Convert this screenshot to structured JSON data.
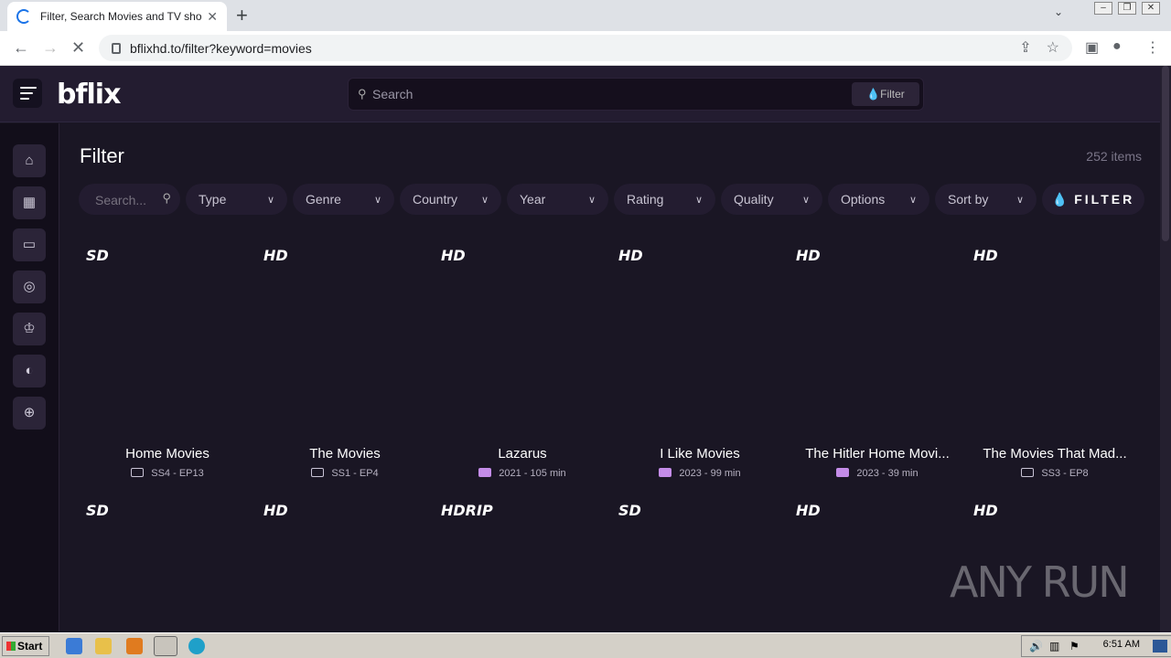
{
  "browser": {
    "tab_title": "Filter, Search Movies and TV shows",
    "url": "bflixhd.to/filter?keyword=movies"
  },
  "header": {
    "logo_main": "bflix",
    "search_placeholder": "Search",
    "filter_button": "Filter"
  },
  "sidebar": {
    "items": [
      {
        "icon": "home-icon",
        "glyph": "⌂"
      },
      {
        "icon": "clapperboard-icon",
        "glyph": "▦"
      },
      {
        "icon": "tv-icon",
        "glyph": "▭"
      },
      {
        "icon": "fire-icon",
        "glyph": "◎"
      },
      {
        "icon": "trophy-icon",
        "glyph": "♔"
      },
      {
        "icon": "palette-icon",
        "glyph": "◐"
      },
      {
        "icon": "globe-icon",
        "glyph": "⊕"
      }
    ]
  },
  "main": {
    "title": "Filter",
    "count": "252 items",
    "search_placeholder": "Search...",
    "filters": [
      "Type",
      "Genre",
      "Country",
      "Year",
      "Rating",
      "Quality",
      "Options",
      "Sort by"
    ],
    "filter_button": "FILTER"
  },
  "cards_row1": [
    {
      "quality": "SD",
      "title": "Home Movies",
      "kind": "tv",
      "meta": "SS4 - EP13"
    },
    {
      "quality": "HD",
      "title": "The Movies",
      "kind": "tv",
      "meta": "SS1 - EP4"
    },
    {
      "quality": "HD",
      "title": "Lazarus",
      "kind": "film",
      "meta": "2021 - 105 min"
    },
    {
      "quality": "HD",
      "title": "I Like Movies",
      "kind": "film",
      "meta": "2023 - 99 min"
    },
    {
      "quality": "HD",
      "title": "The Hitler Home Movi...",
      "kind": "film",
      "meta": "2023 - 39 min"
    },
    {
      "quality": "HD",
      "title": "The Movies That Mad...",
      "kind": "tv",
      "meta": "SS3 - EP8"
    }
  ],
  "cards_row2": [
    {
      "quality": "SD"
    },
    {
      "quality": "HD"
    },
    {
      "quality": "HDRIP"
    },
    {
      "quality": "SD"
    },
    {
      "quality": "HD"
    },
    {
      "quality": "HD"
    }
  ],
  "watermark": "ANY RUN",
  "taskbar": {
    "start_label": "Start",
    "clock": "6:51 AM"
  }
}
